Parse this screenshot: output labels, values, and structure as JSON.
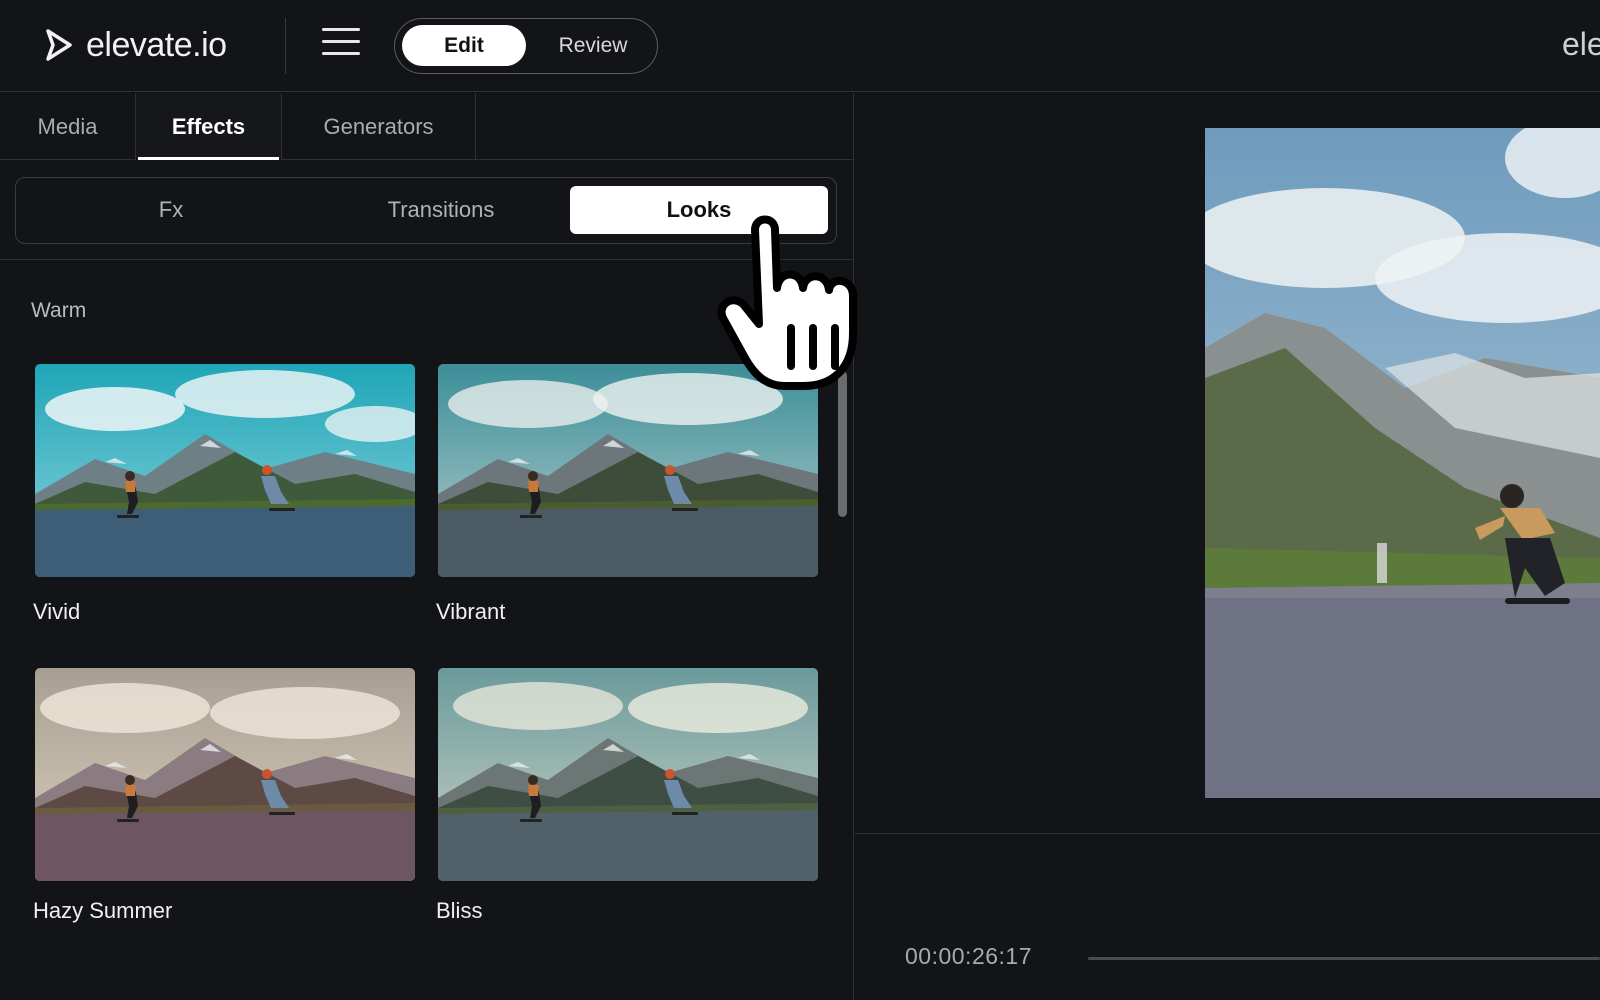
{
  "app": {
    "logo_text": "elevate.io",
    "top_right_text": "ele",
    "menu_icon": "hamburger-menu-icon"
  },
  "mode_toggle": {
    "options": [
      "Edit",
      "Review"
    ],
    "selected": "Edit"
  },
  "panel_tabs": {
    "items": [
      "Media",
      "Effects",
      "Generators"
    ],
    "selected": "Effects"
  },
  "effect_types": {
    "items": [
      "Fx",
      "Transitions",
      "Looks"
    ],
    "selected": "Looks"
  },
  "looks": {
    "section_title": "Warm",
    "items": [
      {
        "name": "Vivid"
      },
      {
        "name": "Vibrant"
      },
      {
        "name": "Hazy Summer"
      },
      {
        "name": "Bliss"
      }
    ]
  },
  "preview": {
    "timecode": "00:00:26:17"
  },
  "cursor": {
    "icon": "pointing-hand-cursor-icon"
  }
}
